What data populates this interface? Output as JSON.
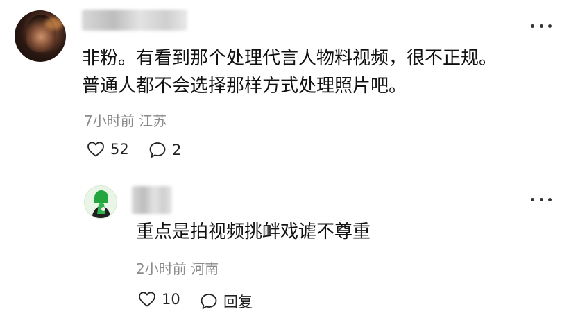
{
  "comment": {
    "text": "非粉。有看到那个处理代言人物料视频，很不正规。\n普通人都不会选择那样方式处理照片吧。",
    "meta": "7小时前  江苏",
    "like_count": "52",
    "reply_count": "2",
    "icons": {
      "like": "heart-outline-icon",
      "reply": "speech-bubble-icon",
      "more": "more-dots-icon"
    }
  },
  "reply": {
    "text": "重点是拍视频挑衅戏谑不尊重",
    "meta": "2小时前  河南",
    "like_count": "10",
    "reply_label": "回复",
    "icons": {
      "like": "heart-outline-icon",
      "reply": "speech-bubble-icon",
      "more": "more-dots-icon"
    }
  }
}
